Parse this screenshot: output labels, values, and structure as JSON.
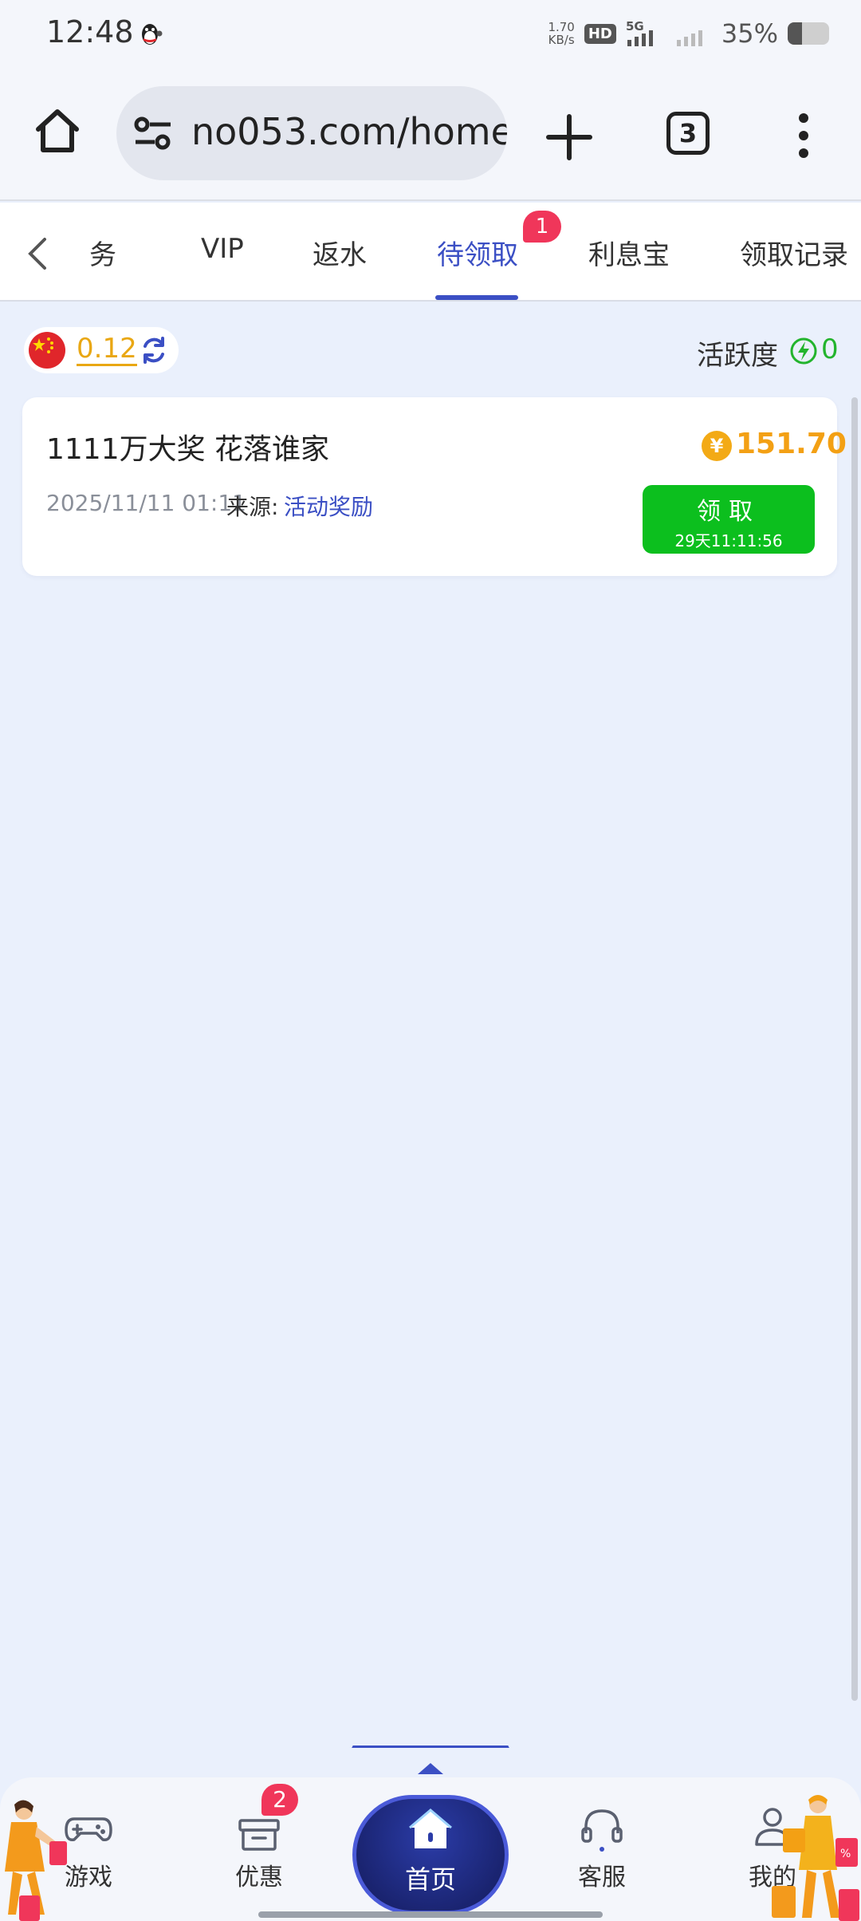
{
  "status_bar": {
    "time": "12:48",
    "net_speed_value": "1.70",
    "net_speed_unit": "KB/s",
    "hd_label": "HD",
    "network": "5G",
    "battery_percent": "35%",
    "battery_level": 0.35
  },
  "browser": {
    "url": "no053.com/home",
    "tab_count": "3"
  },
  "tabs": {
    "items": [
      {
        "label": "任务"
      },
      {
        "label": "VIP"
      },
      {
        "label": "返水"
      },
      {
        "label": "待领取"
      },
      {
        "label": "利息宝"
      },
      {
        "label": "领取记录"
      }
    ],
    "active_index": 3,
    "pending_badge": "1"
  },
  "balance": {
    "value": "0.12",
    "activity_label": "活跃度",
    "activity_value": "0"
  },
  "reward": {
    "title": "1111万大奖 花落谁家",
    "date": "2025/11/11 01:11",
    "source_label": "来源:",
    "source": "活动奖励",
    "currency_symbol": "¥",
    "amount": "151.70",
    "claim_label": "领取",
    "claim_timer": "29天11:11:56"
  },
  "bottom_nav": {
    "games": "游戏",
    "offers": "优惠",
    "offers_badge": "2",
    "home": "首页",
    "service": "客服",
    "mine": "我的"
  },
  "colors": {
    "accent": "#3b4fc4",
    "claim_green": "#0cbf1e",
    "gold": "#f3a014",
    "badge_red": "#f0365a",
    "background": "#eaf0fc"
  }
}
